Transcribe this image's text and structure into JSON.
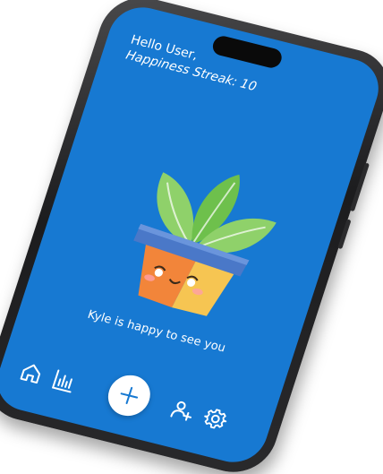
{
  "header": {
    "greeting": "Hello User,",
    "streak": "Happiness Streak: 10"
  },
  "plant": {
    "icon": "happy-plant-icon",
    "message": "Kyle is happy to see you"
  },
  "nav": {
    "items": [
      {
        "icon": "home-icon"
      },
      {
        "icon": "bar-chart-icon"
      },
      {
        "icon": "plus-icon"
      },
      {
        "icon": "add-friend-icon"
      },
      {
        "icon": "gear-icon"
      }
    ]
  },
  "colors": {
    "screen_background": "#1779d2",
    "text": "#ffffff",
    "leaf": "#7dcb5a",
    "pot_rim": "#4a78c8",
    "pot_left": "#f2853a",
    "pot_right": "#f6c552"
  }
}
